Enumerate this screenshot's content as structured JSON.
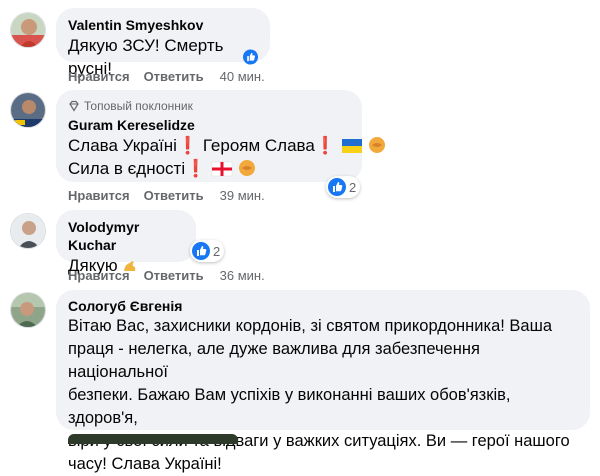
{
  "comments": [
    {
      "author": "Valentin Smyeshkov",
      "lines": [
        "Дякую ЗСУ! Смерть русні!"
      ],
      "like_label": "Нравится",
      "reply_label": "Ответить",
      "time": "40 мин."
    },
    {
      "badge": "Топовый поклонник",
      "author": "Guram Kereselidze",
      "line1_a": "Слава Україні",
      "line1_b": "Героям Слава",
      "line2": "Сила в єдності",
      "like_label": "Нравится",
      "reply_label": "Ответить",
      "time": "39 мин.",
      "reactions": "2"
    },
    {
      "author": "Volodymyr Kuchar",
      "text": "Дякую",
      "like_label": "Нравится",
      "reply_label": "Ответить",
      "time": "36 мин.",
      "reactions": "2"
    },
    {
      "author": "Сологуб Євгенія",
      "lines": [
        "Вітаю Вас, захисники кордонів, зі святом прикордонника! Ваша",
        "праця - нелегка, але дуже важлива для забезпечення національної",
        "безпеки. Бажаю Вам успіхів у виконанні ваших обов'язків, здоров'я,",
        "віри у свої сили та відваги у важких ситуаціях. Ви — герої нашого",
        "часу! Слава Україні!"
      ]
    }
  ],
  "icons": {
    "like": "like-thumb-icon",
    "badge": "diamond-icon",
    "ukraine_flag": "ukraine-flag-icon",
    "georgia_flag": "georgia-flag-icon",
    "handshake": "handshake-emoji",
    "flexed_biceps": "flexed-biceps-emoji",
    "exclamation": "red-exclamation-emoji"
  },
  "colors": {
    "bubble": "#f0f2f5",
    "meta_text": "#65676b",
    "like_blue": "#1877f2"
  }
}
